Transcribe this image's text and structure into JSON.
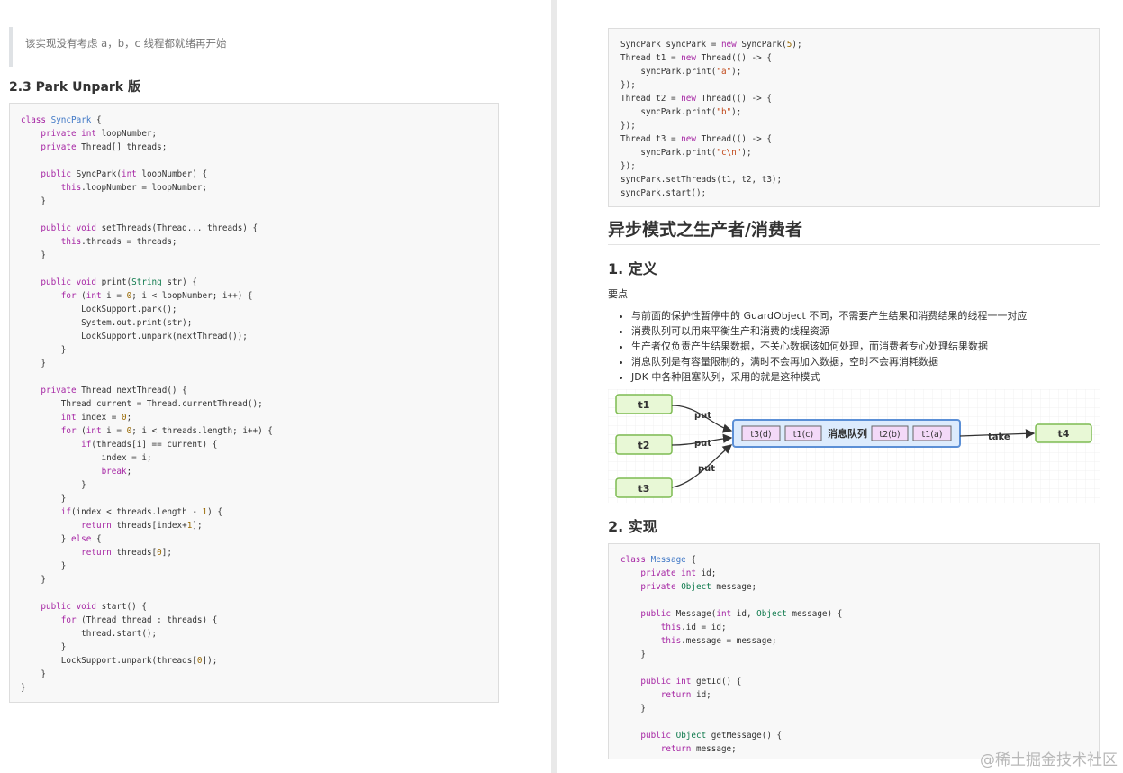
{
  "left": {
    "quote_text": "该实现没有考虑 a，b，c 线程都就绪再开始",
    "section_heading": "2.3 Park Unpark 版"
  },
  "right": {
    "main_heading": "异步模式之生产者/消费者",
    "sub1": "1. 定义",
    "key_points_label": "要点",
    "bullets": [
      "与前面的保护性暂停中的 GuardObject 不同，不需要产生结果和消费结果的线程一一对应",
      "消费队列可以用来平衡生产和消费的线程资源",
      "生产者仅负责产生结果数据，不关心数据该如何处理，而消费者专心处理结果数据",
      "消息队列是有容量限制的，满时不会再加入数据，空时不会再消耗数据",
      "JDK 中各种阻塞队列，采用的就是这种模式"
    ],
    "sub2": "2. 实现"
  },
  "diagram": {
    "producers": [
      "t1",
      "t2",
      "t3"
    ],
    "put_label": "put",
    "queue_label": "消息队列",
    "queue_items": [
      "t3(d)",
      "t1(c)",
      "t2(b)",
      "t1(a)"
    ],
    "take_label": "take",
    "consumer": "t4",
    "colors": {
      "thread_fill": "#e8f8d6",
      "thread_border": "#7dbb52",
      "queue_fill": "#dcebfd",
      "queue_border": "#5b8fd6",
      "item_fill": "#f3d9f8"
    }
  },
  "watermark": "@稀土掘金技术社区",
  "code": {
    "syncpark": [
      [
        [
          "k",
          "class "
        ],
        [
          "c",
          "SyncPark"
        ],
        [
          "p",
          " {"
        ]
      ],
      [
        [
          "p",
          "    "
        ],
        [
          "k",
          "private int"
        ],
        [
          "p",
          " loopNumber;"
        ]
      ],
      [
        [
          "p",
          "    "
        ],
        [
          "k",
          "private"
        ],
        [
          "p",
          " Thread[] threads;"
        ]
      ],
      [
        [
          "p",
          ""
        ]
      ],
      [
        [
          "p",
          "    "
        ],
        [
          "k",
          "public"
        ],
        [
          "p",
          " SyncPark("
        ],
        [
          "k",
          "int"
        ],
        [
          "p",
          " loopNumber) {"
        ]
      ],
      [
        [
          "p",
          "        "
        ],
        [
          "k",
          "this"
        ],
        [
          "p",
          ".loopNumber = loopNumber;"
        ]
      ],
      [
        [
          "p",
          "    }"
        ]
      ],
      [
        [
          "p",
          ""
        ]
      ],
      [
        [
          "p",
          "    "
        ],
        [
          "k",
          "public void"
        ],
        [
          "p",
          " setThreads(Thread... threads) {"
        ]
      ],
      [
        [
          "p",
          "        "
        ],
        [
          "k",
          "this"
        ],
        [
          "p",
          ".threads = threads;"
        ]
      ],
      [
        [
          "p",
          "    }"
        ]
      ],
      [
        [
          "p",
          ""
        ]
      ],
      [
        [
          "p",
          "    "
        ],
        [
          "k",
          "public void"
        ],
        [
          "p",
          " print("
        ],
        [
          "t",
          "String"
        ],
        [
          "p",
          " str) {"
        ]
      ],
      [
        [
          "p",
          "        "
        ],
        [
          "k",
          "for"
        ],
        [
          "p",
          " ("
        ],
        [
          "k",
          "int"
        ],
        [
          "p",
          " i = "
        ],
        [
          "n",
          "0"
        ],
        [
          "p",
          "; i < loopNumber; i++) {"
        ]
      ],
      [
        [
          "p",
          "            LockSupport.park();"
        ]
      ],
      [
        [
          "p",
          "            System.out.print(str);"
        ]
      ],
      [
        [
          "p",
          "            LockSupport.unpark(nextThread());"
        ]
      ],
      [
        [
          "p",
          "        }"
        ]
      ],
      [
        [
          "p",
          "    }"
        ]
      ],
      [
        [
          "p",
          ""
        ]
      ],
      [
        [
          "p",
          "    "
        ],
        [
          "k",
          "private"
        ],
        [
          "p",
          " Thread nextThread() {"
        ]
      ],
      [
        [
          "p",
          "        Thread current = Thread.currentThread();"
        ]
      ],
      [
        [
          "p",
          "        "
        ],
        [
          "k",
          "int"
        ],
        [
          "p",
          " index = "
        ],
        [
          "n",
          "0"
        ],
        [
          "p",
          ";"
        ]
      ],
      [
        [
          "p",
          "        "
        ],
        [
          "k",
          "for"
        ],
        [
          "p",
          " ("
        ],
        [
          "k",
          "int"
        ],
        [
          "p",
          " i = "
        ],
        [
          "n",
          "0"
        ],
        [
          "p",
          "; i < threads.length; i++) {"
        ]
      ],
      [
        [
          "p",
          "            "
        ],
        [
          "k",
          "if"
        ],
        [
          "p",
          "(threads[i] == current) {"
        ]
      ],
      [
        [
          "p",
          "                index = i;"
        ]
      ],
      [
        [
          "p",
          "                "
        ],
        [
          "k",
          "break"
        ],
        [
          "p",
          ";"
        ]
      ],
      [
        [
          "p",
          "            }"
        ]
      ],
      [
        [
          "p",
          "        }"
        ]
      ],
      [
        [
          "p",
          "        "
        ],
        [
          "k",
          "if"
        ],
        [
          "p",
          "(index < threads.length - "
        ],
        [
          "n",
          "1"
        ],
        [
          "p",
          ") {"
        ]
      ],
      [
        [
          "p",
          "            "
        ],
        [
          "k",
          "return"
        ],
        [
          "p",
          " threads[index+"
        ],
        [
          "n",
          "1"
        ],
        [
          "p",
          "];"
        ]
      ],
      [
        [
          "p",
          "        } "
        ],
        [
          "k",
          "else"
        ],
        [
          "p",
          " {"
        ]
      ],
      [
        [
          "p",
          "            "
        ],
        [
          "k",
          "return"
        ],
        [
          "p",
          " threads["
        ],
        [
          "n",
          "0"
        ],
        [
          "p",
          "];"
        ]
      ],
      [
        [
          "p",
          "        }"
        ]
      ],
      [
        [
          "p",
          "    }"
        ]
      ],
      [
        [
          "p",
          ""
        ]
      ],
      [
        [
          "p",
          "    "
        ],
        [
          "k",
          "public void"
        ],
        [
          "p",
          " start() {"
        ]
      ],
      [
        [
          "p",
          "        "
        ],
        [
          "k",
          "for"
        ],
        [
          "p",
          " (Thread thread : threads) {"
        ]
      ],
      [
        [
          "p",
          "            thread.start();"
        ]
      ],
      [
        [
          "p",
          "        }"
        ]
      ],
      [
        [
          "p",
          "        LockSupport.unpark(threads["
        ],
        [
          "n",
          "0"
        ],
        [
          "p",
          "]);"
        ]
      ],
      [
        [
          "p",
          "    }"
        ]
      ],
      [
        [
          "p",
          "}"
        ]
      ]
    ],
    "usage": [
      [
        [
          "p",
          "SyncPark syncPark = "
        ],
        [
          "k",
          "new"
        ],
        [
          "p",
          " SyncPark("
        ],
        [
          "n",
          "5"
        ],
        [
          "p",
          ");"
        ]
      ],
      [
        [
          "p",
          "Thread t1 = "
        ],
        [
          "k",
          "new"
        ],
        [
          "p",
          " Thread(() -> {"
        ]
      ],
      [
        [
          "p",
          "    syncPark.print("
        ],
        [
          "s",
          "\"a\""
        ],
        [
          "p",
          ");"
        ]
      ],
      [
        [
          "p",
          "});"
        ]
      ],
      [
        [
          "p",
          "Thread t2 = "
        ],
        [
          "k",
          "new"
        ],
        [
          "p",
          " Thread(() -> {"
        ]
      ],
      [
        [
          "p",
          "    syncPark.print("
        ],
        [
          "s",
          "\"b\""
        ],
        [
          "p",
          ");"
        ]
      ],
      [
        [
          "p",
          "});"
        ]
      ],
      [
        [
          "p",
          "Thread t3 = "
        ],
        [
          "k",
          "new"
        ],
        [
          "p",
          " Thread(() -> {"
        ]
      ],
      [
        [
          "p",
          "    syncPark.print("
        ],
        [
          "s",
          "\"c\\n\""
        ],
        [
          "p",
          ");"
        ]
      ],
      [
        [
          "p",
          "});"
        ]
      ],
      [
        [
          "p",
          "syncPark.setThreads(t1, t2, t3);"
        ]
      ],
      [
        [
          "p",
          "syncPark.start();"
        ]
      ]
    ],
    "message": [
      [
        [
          "k",
          "class "
        ],
        [
          "c",
          "Message"
        ],
        [
          "p",
          " {"
        ]
      ],
      [
        [
          "p",
          "    "
        ],
        [
          "k",
          "private int"
        ],
        [
          "p",
          " id;"
        ]
      ],
      [
        [
          "p",
          "    "
        ],
        [
          "k",
          "private"
        ],
        [
          "p",
          " "
        ],
        [
          "t",
          "Object"
        ],
        [
          "p",
          " message;"
        ]
      ],
      [
        [
          "p",
          ""
        ]
      ],
      [
        [
          "p",
          "    "
        ],
        [
          "k",
          "public"
        ],
        [
          "p",
          " Message("
        ],
        [
          "k",
          "int"
        ],
        [
          "p",
          " id, "
        ],
        [
          "t",
          "Object"
        ],
        [
          "p",
          " message) {"
        ]
      ],
      [
        [
          "p",
          "        "
        ],
        [
          "k",
          "this"
        ],
        [
          "p",
          ".id = id;"
        ]
      ],
      [
        [
          "p",
          "        "
        ],
        [
          "k",
          "this"
        ],
        [
          "p",
          ".message = message;"
        ]
      ],
      [
        [
          "p",
          "    }"
        ]
      ],
      [
        [
          "p",
          ""
        ]
      ],
      [
        [
          "p",
          "    "
        ],
        [
          "k",
          "public int"
        ],
        [
          "p",
          " getId() {"
        ]
      ],
      [
        [
          "p",
          "        "
        ],
        [
          "k",
          "return"
        ],
        [
          "p",
          " id;"
        ]
      ],
      [
        [
          "p",
          "    }"
        ]
      ],
      [
        [
          "p",
          ""
        ]
      ],
      [
        [
          "p",
          "    "
        ],
        [
          "k",
          "public"
        ],
        [
          "p",
          " "
        ],
        [
          "t",
          "Object"
        ],
        [
          "p",
          " getMessage() {"
        ]
      ],
      [
        [
          "p",
          "        "
        ],
        [
          "k",
          "return"
        ],
        [
          "p",
          " message;"
        ]
      ]
    ]
  }
}
